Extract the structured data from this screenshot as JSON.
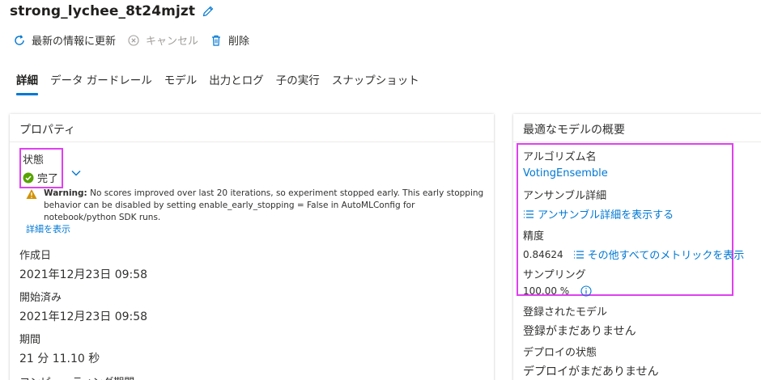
{
  "header": {
    "title": "strong_lychee_8t24mjzt"
  },
  "toolbar": {
    "refresh_label": "最新の情報に更新",
    "cancel_label": "キャンセル",
    "delete_label": "削除"
  },
  "tabs": [
    {
      "label": "詳細"
    },
    {
      "label": "データ ガードレール"
    },
    {
      "label": "モデル"
    },
    {
      "label": "出力とログ"
    },
    {
      "label": "子の実行"
    },
    {
      "label": "スナップショット"
    }
  ],
  "properties": {
    "title": "プロパティ",
    "status_label": "状態",
    "status_value": "完了",
    "warning_bold": "Warning:",
    "warning_text": " No scores improved over last 20 iterations, so experiment stopped early. This early stopping behavior can be disabled by setting enable_early_stopping = False in AutoMLConfig for notebook/python SDK runs.",
    "details_link": "詳細を表示",
    "created_label": "作成日",
    "created_value": "2021年12月23日 09:58",
    "started_label": "開始済み",
    "started_value": "2021年12月23日 09:58",
    "duration_label": "期間",
    "duration_value": "21 分 11.10 秒",
    "compute_label": "コンピューティング期間"
  },
  "best_model": {
    "title": "最適なモデルの概要",
    "algorithm_label": "アルゴリズム名",
    "algorithm_value": "VotingEnsemble",
    "ensemble_label": "アンサンブル詳細",
    "ensemble_link": "アンサンブル詳細を表示する",
    "accuracy_label": "精度",
    "accuracy_value": "0.84624",
    "metrics_link": "その他すべてのメトリックを表示",
    "sampling_label": "サンプリング",
    "sampling_value": "100.00 %",
    "registered_label": "登録されたモデル",
    "registered_value": "登録がまだありません",
    "deploy_label": "デプロイの状態",
    "deploy_value": "デプロイがまだありません"
  },
  "colors": {
    "accent": "#0078d4",
    "success": "#57a300",
    "warning": "#d29200",
    "highlight": "#e040f0"
  }
}
